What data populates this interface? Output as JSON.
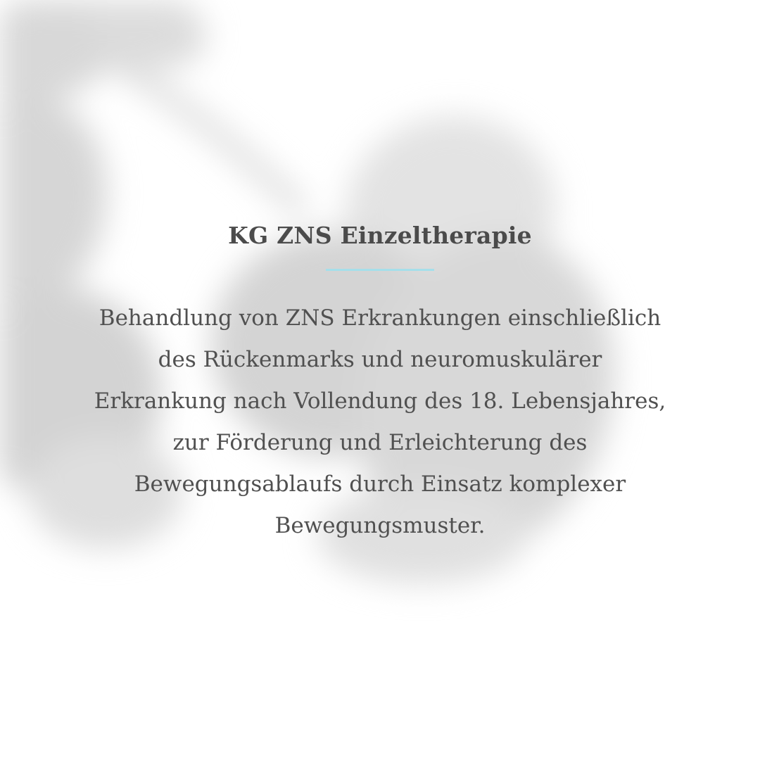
{
  "title": "KG ZNS Einzeltherapie",
  "description_lines": [
    "Behandlung von ZNS Erkrankungen einschließlich",
    "des Rückenmarks und neuromuskulärer",
    "Erkrankung nach Vollendung des 18. Lebensjahres,",
    "zur Förderung und Erleichterung des",
    "Bewegungsablaufs durch Einsatz komplexer",
    "Bewegungsmuster."
  ],
  "colors": {
    "background": "#ffffff",
    "text": "#4b4b4b",
    "accent": "#a5dfea",
    "shadow": "#d9d9d9"
  },
  "background_decoration": "blurred-leaf-shadow"
}
